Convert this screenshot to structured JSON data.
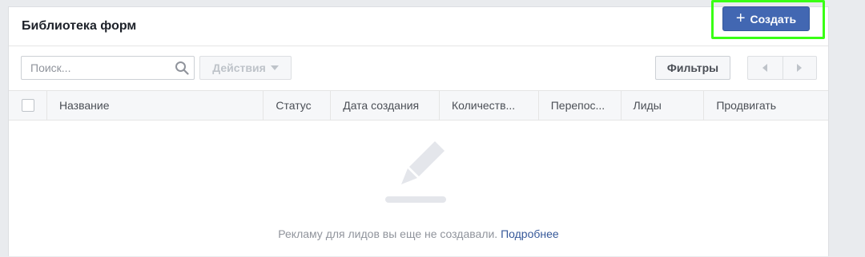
{
  "header": {
    "title": "Библиотека форм",
    "create_label": "Создать",
    "create_icon": "plus-icon"
  },
  "toolbar": {
    "search_placeholder": "Поиск...",
    "search_value": "",
    "actions_label": "Действия",
    "filters_label": "Фильтры"
  },
  "table": {
    "columns": [
      "Название",
      "Статус",
      "Дата создания",
      "Количеств...",
      "Перепос...",
      "Лиды",
      "Продвигать"
    ]
  },
  "empty_state": {
    "message": "Рекламу для лидов вы еще не создавали.",
    "link_label": "Подробнее"
  },
  "colors": {
    "primary_button": "#4267b2",
    "link": "#365899",
    "highlight": "#39ff14",
    "background": "#e9ebee"
  }
}
